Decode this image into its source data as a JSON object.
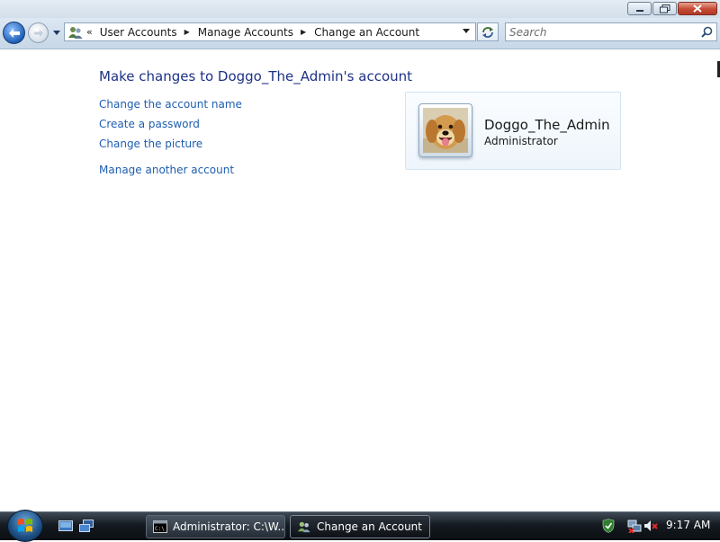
{
  "window": {
    "caption_buttons": [
      {
        "name": "minimize",
        "icon": "minimize-icon"
      },
      {
        "name": "maximize",
        "icon": "restore-icon"
      },
      {
        "name": "close",
        "icon": "close-icon"
      }
    ]
  },
  "navigation": {
    "back_icon": "back-arrow-icon",
    "forward_icon": "forward-arrow-icon",
    "address_icon": "user-accounts-icon",
    "overflow": "«",
    "breadcrumbs": [
      {
        "label": "User Accounts"
      },
      {
        "label": "Manage Accounts"
      },
      {
        "label": "Change an Account"
      }
    ],
    "search_placeholder": "Search"
  },
  "main": {
    "heading": "Make changes to Doggo_The_Admin's account",
    "tasks": [
      {
        "label": "Change the account name"
      },
      {
        "label": "Create a password"
      },
      {
        "label": "Change the picture"
      },
      {
        "label": "Manage another account"
      }
    ],
    "account": {
      "name": "Doggo_The_Admin",
      "type": "Administrator",
      "picture": "golden-retriever-avatar"
    }
  },
  "taskbar": {
    "start_icon": "windows-start-orb-icon",
    "quick_launch": [
      {
        "icon": "show-desktop-icon"
      },
      {
        "icon": "switch-windows-icon"
      }
    ],
    "buttons": [
      {
        "label": "Administrator: C:\\W...",
        "icon": "command-prompt-icon",
        "active": false
      },
      {
        "label": "Change an Account",
        "icon": "user-accounts-icon",
        "active": true
      }
    ],
    "tray_icons": [
      "update-shield-icon",
      "network-disconnected-icon",
      "volume-muted-icon"
    ],
    "clock": "9:17 AM"
  },
  "colors": {
    "link": "#1e5eb0",
    "heading": "#1e3287",
    "taskbar": "#141a20"
  }
}
